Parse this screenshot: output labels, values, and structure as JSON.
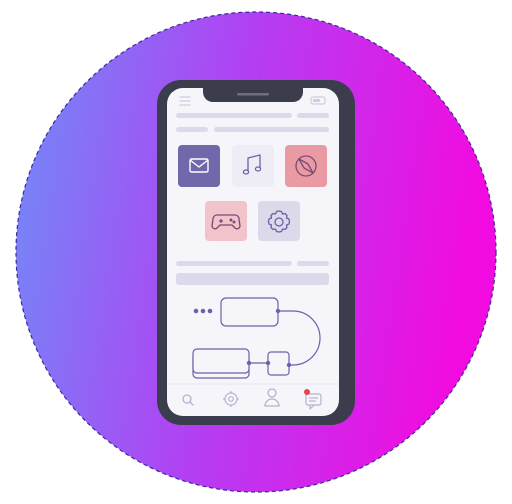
{
  "colors": {
    "gradient_start": "#6f8cf7",
    "gradient_mid": "#b43ef3",
    "gradient_end": "#f20be0",
    "circle_border": "#3b2a9a",
    "phone_body": "#3c3d4c",
    "phone_screen": "#f6f5fa",
    "placeholder_bar": "#dcdaea",
    "line_color": "#6c61a8",
    "icon_mail_bg": "#6f68ab",
    "icon_music_bg": "#eeedf6",
    "icon_compass_bg": "#ea9aa3",
    "icon_gamepad_bg": "#f3c3cb",
    "icon_settings_bg": "#dcdaea"
  },
  "app_icons": [
    {
      "name": "mail-icon"
    },
    {
      "name": "music-icon"
    },
    {
      "name": "compass-icon"
    },
    {
      "name": "gamepad-icon"
    },
    {
      "name": "settings-icon"
    }
  ],
  "nav_icons": [
    {
      "name": "search-icon"
    },
    {
      "name": "gear-icon"
    },
    {
      "name": "user-icon"
    },
    {
      "name": "chat-icon"
    }
  ]
}
